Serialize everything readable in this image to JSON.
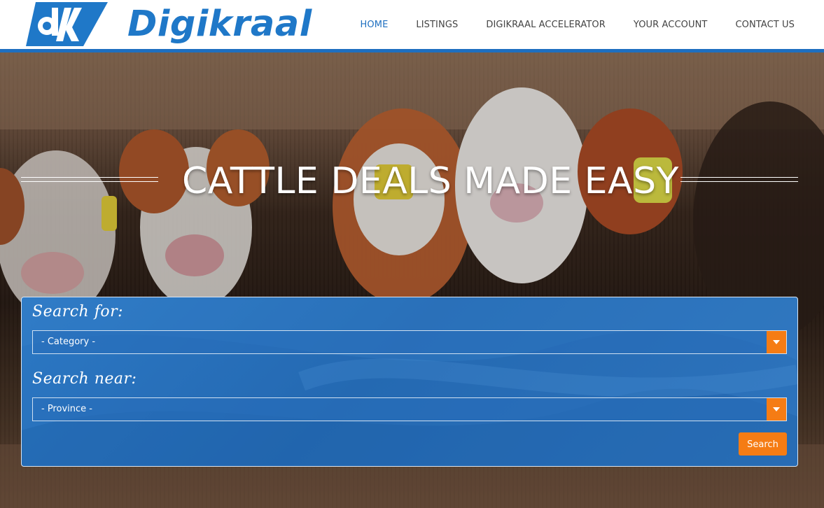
{
  "brand": {
    "name": "Digikraal",
    "logo_icon": "dk-logo-icon"
  },
  "colors": {
    "brand_blue": "#1e6fc0",
    "accent_orange": "#f57c14"
  },
  "nav": {
    "items": [
      {
        "label": "HOME",
        "active": true
      },
      {
        "label": "LISTINGS",
        "active": false
      },
      {
        "label": "DIGIKRAAL ACCELERATOR",
        "active": false
      },
      {
        "label": "YOUR ACCOUNT",
        "active": false
      },
      {
        "label": "CONTACT US",
        "active": false
      }
    ]
  },
  "hero": {
    "title": "CATTLE DEALS MADE EASY"
  },
  "search": {
    "for_label": "Search for:",
    "category_value": "- Category -",
    "near_label": "Search near:",
    "province_value": "- Province -",
    "button_label": "Search"
  }
}
